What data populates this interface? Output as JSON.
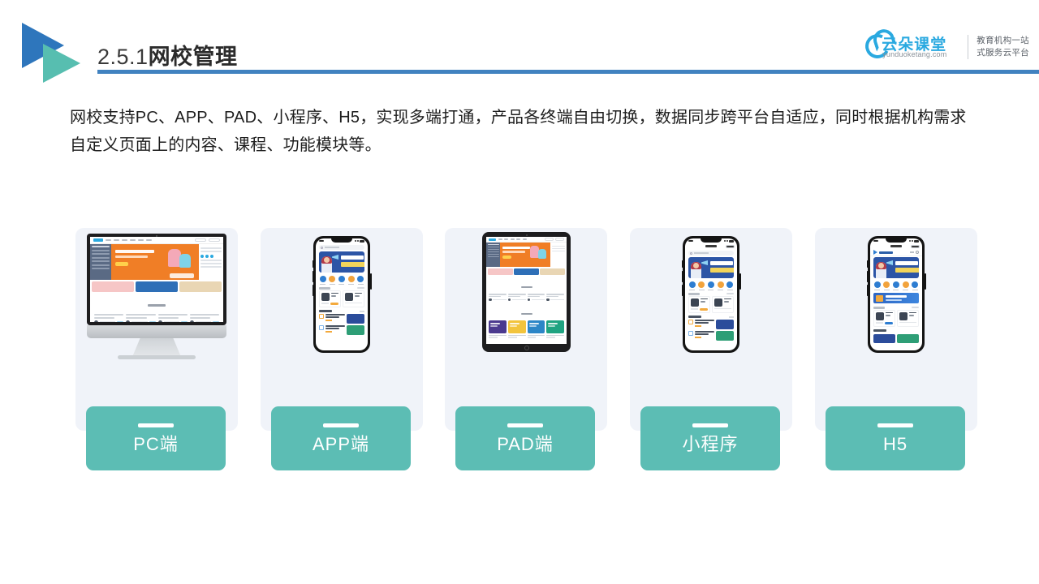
{
  "header": {
    "title_number": "2.5.1",
    "title_text": "网校管理",
    "logo_icon": "double-triangle-logo",
    "accent_color": "#4182C0"
  },
  "brand": {
    "name": "云朵课堂",
    "url": "yunduoketang.com",
    "slogan_line1": "教育机构一站",
    "slogan_line2": "式服务云平台",
    "icon": "cloud-icon",
    "color": "#2AA9E0"
  },
  "intro": {
    "text": "网校支持PC、APP、PAD、小程序、H5，实现多端打通，产品各终端自由切换，数据同步跨平台自适应，同时根据机构需求自定义页面上的内容、课程、功能模块等。"
  },
  "cards": [
    {
      "label": "PC端",
      "device": "desktop-monitor"
    },
    {
      "label": "APP端",
      "device": "smartphone"
    },
    {
      "label": "PAD端",
      "device": "tablet"
    },
    {
      "label": "小程序",
      "device": "smartphone-miniprogram"
    },
    {
      "label": "H5",
      "device": "smartphone-browser"
    }
  ],
  "theme": {
    "label_color": "#5CBDB4",
    "card_bg": "#F0F3F9",
    "banner_orange": "#F07E26",
    "banner_blue": "#2C55A6"
  }
}
